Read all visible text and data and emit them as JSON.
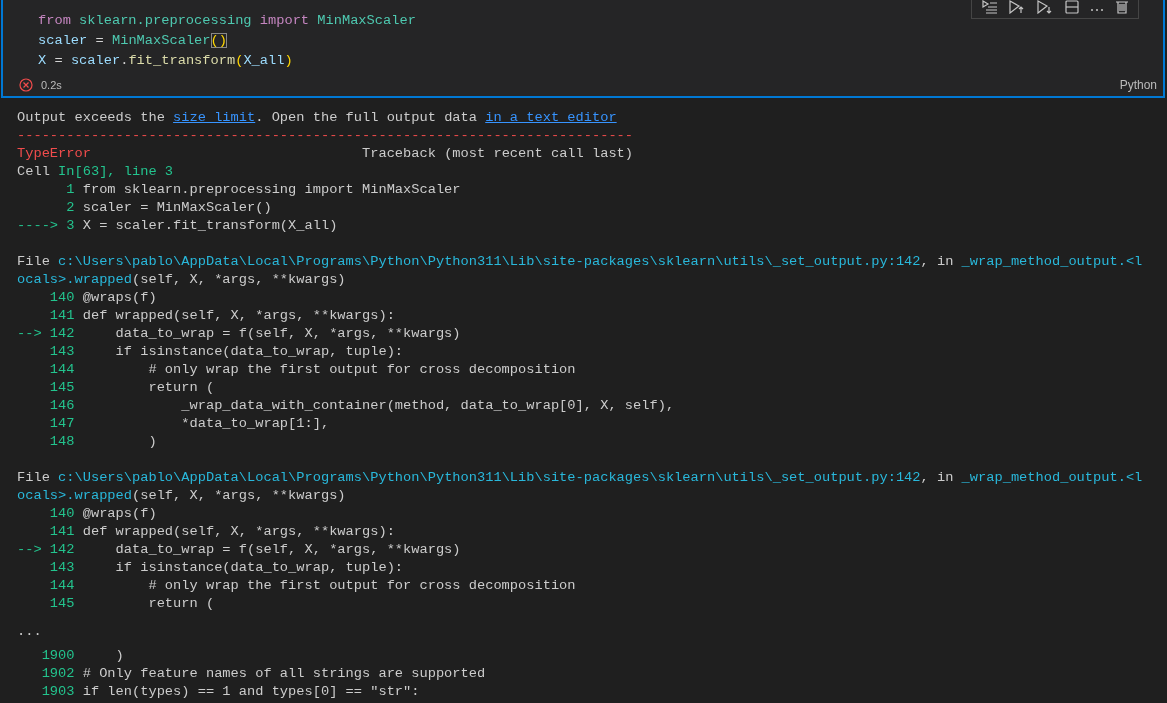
{
  "cell": {
    "code": [
      {
        "tokens": [
          {
            "text": "from ",
            "kind": "kw"
          },
          {
            "text": "sklearn.preprocessing ",
            "kind": "cls"
          },
          {
            "text": "import ",
            "kind": "kw"
          },
          {
            "text": "MinMaxScaler",
            "kind": "cls"
          }
        ]
      },
      {
        "tokens": [
          {
            "text": "scaler",
            "kind": "var"
          },
          {
            "text": " = ",
            "kind": "op"
          },
          {
            "text": "MinMaxScaler",
            "kind": "cls"
          },
          {
            "text": "()",
            "kind": "br",
            "bracket_match": true
          }
        ]
      },
      {
        "tokens": [
          {
            "text": "X",
            "kind": "var"
          },
          {
            "text": " = ",
            "kind": "op"
          },
          {
            "text": "scaler",
            "kind": "var"
          },
          {
            "text": ".",
            "kind": "op"
          },
          {
            "text": "fit_transform",
            "kind": "fn"
          },
          {
            "text": "(",
            "kind": "br"
          },
          {
            "text": "X_all",
            "kind": "var"
          },
          {
            "text": ")",
            "kind": "br"
          }
        ]
      }
    ],
    "failed": true,
    "duration": "0.2s",
    "language": "Python"
  },
  "output": {
    "message": [
      {
        "text": "Output exceeds the ",
        "kind": "plain"
      },
      {
        "text": "size limit",
        "kind": "link"
      },
      {
        "text": ". Open the full output data ",
        "kind": "plain"
      },
      {
        "text": "in a text editor",
        "kind": "link"
      }
    ],
    "lines": [
      {
        "segs": [
          {
            "text": "---------------------------------------------------------------------------",
            "kind": "red"
          }
        ]
      },
      {
        "segs": [
          {
            "text": "TypeError",
            "kind": "red"
          },
          {
            "text": "                                 Traceback (most recent call last)",
            "kind": "plain"
          }
        ]
      },
      {
        "segs": [
          {
            "text": "Cell ",
            "kind": "plain"
          },
          {
            "text": "In[63], line 3",
            "kind": "green"
          }
        ]
      },
      {
        "segs": [
          {
            "text": "      1",
            "kind": "green"
          },
          {
            "text": " from sklearn.preprocessing import MinMaxScaler",
            "kind": "plain"
          }
        ]
      },
      {
        "segs": [
          {
            "text": "      2",
            "kind": "green"
          },
          {
            "text": " scaler = MinMaxScaler()",
            "kind": "plain"
          }
        ]
      },
      {
        "segs": [
          {
            "text": "----> 3",
            "kind": "green"
          },
          {
            "text": " X = scaler.fit_transform(X_all)",
            "kind": "plain"
          }
        ]
      },
      {
        "kind": "gap"
      },
      {
        "segs": [
          {
            "text": "File ",
            "kind": "plain"
          },
          {
            "text": "c:\\Users\\pablo\\AppData\\Local\\Programs\\Python\\Python311\\Lib\\site-packages\\sklearn\\utils\\_set_output.py:142",
            "kind": "cyan"
          },
          {
            "text": ", in ",
            "kind": "plain"
          },
          {
            "text": "_wrap_method_output.<l",
            "kind": "cyan"
          }
        ]
      },
      {
        "segs": [
          {
            "text": "ocals>.wrapped",
            "kind": "cyan"
          },
          {
            "text": "(self, X, *args, **kwargs)",
            "kind": "plain"
          }
        ]
      },
      {
        "segs": [
          {
            "text": "    140",
            "kind": "green"
          },
          {
            "text": " @wraps(f)",
            "kind": "plain"
          }
        ]
      },
      {
        "segs": [
          {
            "text": "    141",
            "kind": "green"
          },
          {
            "text": " def wrapped(self, X, *args, **kwargs):",
            "kind": "plain"
          }
        ]
      },
      {
        "segs": [
          {
            "text": "--> 142",
            "kind": "green"
          },
          {
            "text": "     data_to_wrap = f(self, X, *args, **kwargs)",
            "kind": "plain"
          }
        ]
      },
      {
        "segs": [
          {
            "text": "    143",
            "kind": "green"
          },
          {
            "text": "     if isinstance(data_to_wrap, tuple):",
            "kind": "plain"
          }
        ]
      },
      {
        "segs": [
          {
            "text": "    144",
            "kind": "green"
          },
          {
            "text": "         # only wrap the first output for cross decomposition",
            "kind": "plain"
          }
        ]
      },
      {
        "segs": [
          {
            "text": "    145",
            "kind": "green"
          },
          {
            "text": "         return (",
            "kind": "plain"
          }
        ]
      },
      {
        "segs": [
          {
            "text": "    146",
            "kind": "green"
          },
          {
            "text": "             _wrap_data_with_container(method, data_to_wrap[0], X, self),",
            "kind": "plain"
          }
        ]
      },
      {
        "segs": [
          {
            "text": "    147",
            "kind": "green"
          },
          {
            "text": "             *data_to_wrap[1:],",
            "kind": "plain"
          }
        ]
      },
      {
        "segs": [
          {
            "text": "    148",
            "kind": "green"
          },
          {
            "text": "         )",
            "kind": "plain"
          }
        ]
      },
      {
        "kind": "gap"
      },
      {
        "segs": [
          {
            "text": "File ",
            "kind": "plain"
          },
          {
            "text": "c:\\Users\\pablo\\AppData\\Local\\Programs\\Python\\Python311\\Lib\\site-packages\\sklearn\\utils\\_set_output.py:142",
            "kind": "cyan"
          },
          {
            "text": ", in ",
            "kind": "plain"
          },
          {
            "text": "_wrap_method_output.<l",
            "kind": "cyan"
          }
        ]
      },
      {
        "segs": [
          {
            "text": "ocals>.wrapped",
            "kind": "cyan"
          },
          {
            "text": "(self, X, *args, **kwargs)",
            "kind": "plain"
          }
        ]
      },
      {
        "segs": [
          {
            "text": "    140",
            "kind": "green"
          },
          {
            "text": " @wraps(f)",
            "kind": "plain"
          }
        ]
      },
      {
        "segs": [
          {
            "text": "    141",
            "kind": "green"
          },
          {
            "text": " def wrapped(self, X, *args, **kwargs):",
            "kind": "plain"
          }
        ]
      },
      {
        "segs": [
          {
            "text": "--> 142",
            "kind": "green"
          },
          {
            "text": "     data_to_wrap = f(self, X, *args, **kwargs)",
            "kind": "plain"
          }
        ]
      },
      {
        "segs": [
          {
            "text": "    143",
            "kind": "green"
          },
          {
            "text": "     if isinstance(data_to_wrap, tuple):",
            "kind": "plain"
          }
        ]
      },
      {
        "segs": [
          {
            "text": "    144",
            "kind": "green"
          },
          {
            "text": "         # only wrap the first output for cross decomposition",
            "kind": "plain"
          }
        ]
      },
      {
        "segs": [
          {
            "text": "    145",
            "kind": "green"
          },
          {
            "text": "         return (",
            "kind": "plain"
          }
        ]
      },
      {
        "kind": "ellipsis",
        "segs": [
          {
            "text": "...",
            "kind": "plain"
          }
        ]
      },
      {
        "segs": [
          {
            "text": "   1900",
            "kind": "green"
          },
          {
            "text": "     )",
            "kind": "plain"
          }
        ]
      },
      {
        "segs": [
          {
            "text": "   1902",
            "kind": "green"
          },
          {
            "text": " # Only feature names of all strings are supported",
            "kind": "plain"
          }
        ]
      },
      {
        "segs": [
          {
            "text": "   1903",
            "kind": "green"
          },
          {
            "text": " if len(types) == 1 and types[0] == \"str\":",
            "kind": "plain"
          }
        ]
      }
    ]
  }
}
